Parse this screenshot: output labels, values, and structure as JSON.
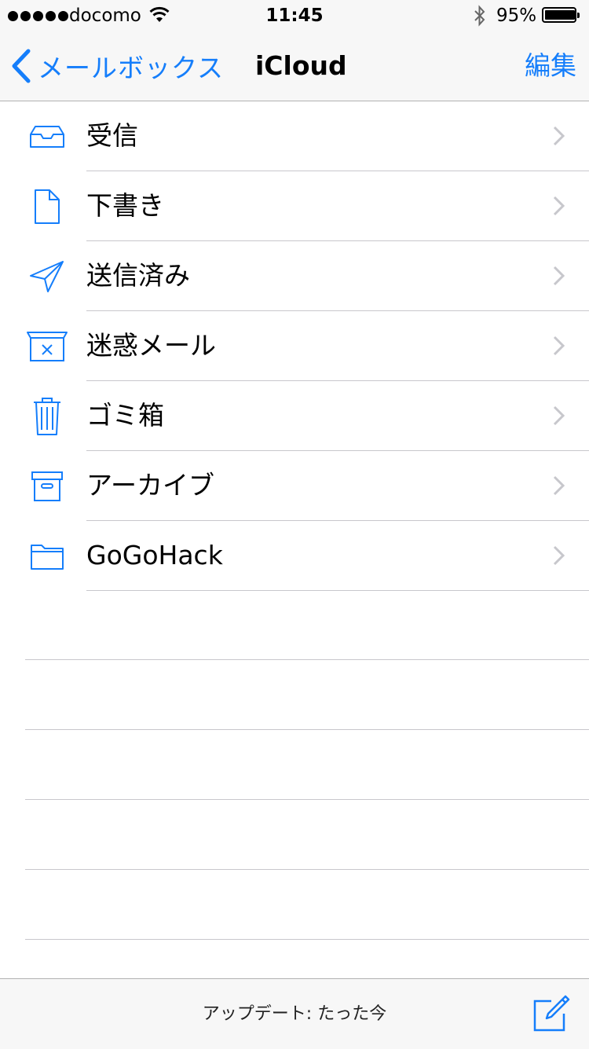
{
  "status_bar": {
    "carrier": "docomo",
    "time": "11:45",
    "battery_percent": "95%",
    "battery_level": 0.95
  },
  "nav": {
    "back_label": "メールボックス",
    "title": "iCloud",
    "edit_label": "編集"
  },
  "mailboxes": [
    {
      "label": "受信",
      "icon": "inbox-icon"
    },
    {
      "label": "下書き",
      "icon": "document-icon"
    },
    {
      "label": "送信済み",
      "icon": "paper-plane-icon"
    },
    {
      "label": "迷惑メール",
      "icon": "junk-box-icon"
    },
    {
      "label": "ゴミ箱",
      "icon": "trash-icon"
    },
    {
      "label": "アーカイブ",
      "icon": "archive-box-icon"
    },
    {
      "label": "GoGoHack",
      "icon": "folder-icon"
    }
  ],
  "toolbar": {
    "status": "アップデート: たった今"
  },
  "colors": {
    "accent": "#157efb",
    "separator": "#c8c7cc",
    "bar_background": "#f7f7f7"
  }
}
